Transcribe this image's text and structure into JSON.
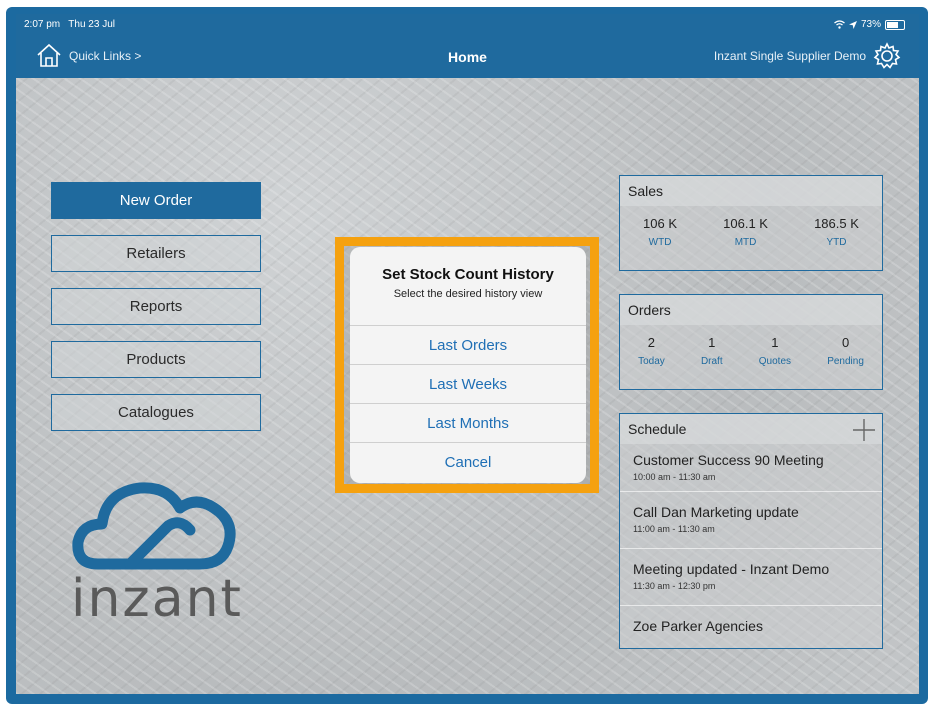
{
  "status": {
    "time": "2:07 pm",
    "date": "Thu 23 Jul",
    "battery": "73%"
  },
  "header": {
    "quick_links": "Quick Links >",
    "title": "Home",
    "supplier": "Inzant Single Supplier Demo"
  },
  "menu": {
    "items": [
      {
        "label": "New Order"
      },
      {
        "label": "Retailers"
      },
      {
        "label": "Reports"
      },
      {
        "label": "Products"
      },
      {
        "label": "Catalogues"
      }
    ]
  },
  "brand": {
    "logo_text": "inzant"
  },
  "sales": {
    "title": "Sales",
    "stats": [
      {
        "value": "106 K",
        "label": "WTD"
      },
      {
        "value": "106.1 K",
        "label": "MTD"
      },
      {
        "value": "186.5 K",
        "label": "YTD"
      }
    ]
  },
  "orders": {
    "title": "Orders",
    "stats": [
      {
        "value": "2",
        "label": "Today"
      },
      {
        "value": "1",
        "label": "Draft"
      },
      {
        "value": "1",
        "label": "Quotes"
      },
      {
        "value": "0",
        "label": "Pending"
      }
    ]
  },
  "schedule": {
    "title": "Schedule",
    "items": [
      {
        "title": "Customer Success 90 Meeting",
        "time": "10:00 am - 11:30 am"
      },
      {
        "title": "Call Dan Marketing update",
        "time": "11:00 am - 11:30 am"
      },
      {
        "title": "Meeting updated - Inzant Demo",
        "time": "11:30 am - 12:30 pm"
      },
      {
        "title": "Zoe Parker Agencies",
        "time": ""
      }
    ]
  },
  "dialog": {
    "title": "Set Stock Count History",
    "subtitle": "Select the desired history view",
    "options": [
      {
        "label": "Last Orders"
      },
      {
        "label": "Last Weeks"
      },
      {
        "label": "Last Months"
      },
      {
        "label": "Cancel"
      }
    ]
  },
  "colors": {
    "brand_blue": "#1f6a9e",
    "highlight": "#f5a10f",
    "link_blue": "#1f6fb5"
  },
  "icons": [
    "home-icon",
    "gear-icon",
    "wifi-icon",
    "location-icon",
    "battery-icon",
    "plus-icon",
    "cloud-logo"
  ]
}
